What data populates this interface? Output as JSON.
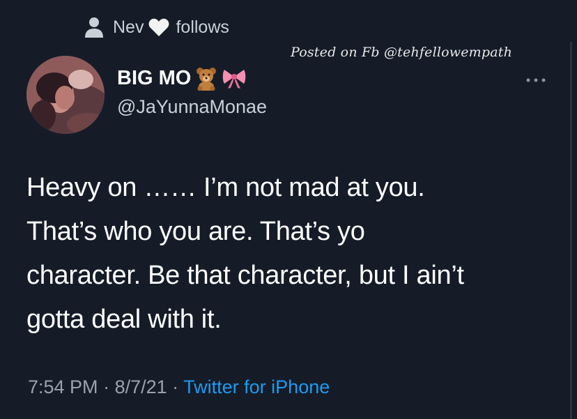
{
  "social_context": {
    "name": "Nev",
    "action": "follows",
    "icons": [
      "person-icon",
      "heart-icon"
    ]
  },
  "watermark": "Posted on Fb @tehfellowempath",
  "user": {
    "display_name": "BIG MO",
    "emojis": [
      "teddy-bear-emoji",
      "ribbon-emoji"
    ],
    "handle": "@JaYunnaMonae"
  },
  "tweet": {
    "lines": [
      "Heavy on …… I’m not mad at you.",
      "That’s who you are. That’s yo",
      "character. Be that character, but I ain’t",
      "gotta deal with it."
    ]
  },
  "meta": {
    "time": "7:54 PM",
    "separator": " · ",
    "date": "8/7/21",
    "source": "Twitter for iPhone"
  },
  "colors": {
    "background": "#151c28",
    "link": "#1d9bf0",
    "secondary_text": "#9aa3ad"
  }
}
